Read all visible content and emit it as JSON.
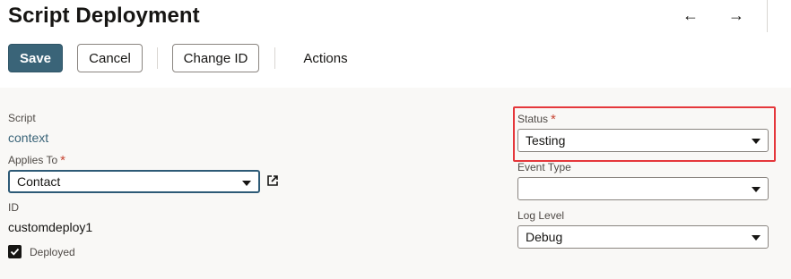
{
  "header": {
    "title": "Script Deployment",
    "back_icon": "arrow-left-icon",
    "forward_icon": "arrow-right-icon",
    "back_glyph": "←",
    "forward_glyph": "→"
  },
  "toolbar": {
    "save_label": "Save",
    "cancel_label": "Cancel",
    "change_id_label": "Change ID",
    "actions_label": "Actions"
  },
  "form": {
    "script": {
      "label": "Script",
      "value": "context"
    },
    "applies_to": {
      "label": "Applies To",
      "required_mark": "*",
      "value": "Contact"
    },
    "id": {
      "label": "ID",
      "value": "customdeploy1"
    },
    "deployed": {
      "label": "Deployed",
      "checked": true
    },
    "status": {
      "label": "Status",
      "required_mark": "*",
      "value": "Testing"
    },
    "event_type": {
      "label": "Event Type",
      "value": ""
    },
    "log_level": {
      "label": "Log Level",
      "value": "Debug"
    }
  },
  "colors": {
    "primary_button": "#3a6478",
    "required": "#c74634",
    "highlight": "#e5373b",
    "link": "#3a6478"
  }
}
